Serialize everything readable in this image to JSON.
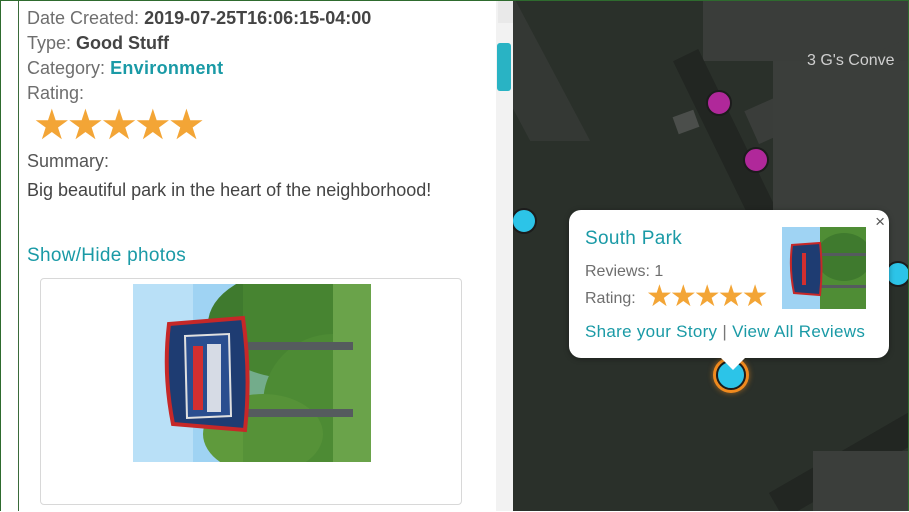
{
  "detail": {
    "date_label": "Date Created:",
    "date_value": "2019-07-25T16:06:15-04:00",
    "type_label": "Type:",
    "type_value": "Good Stuff",
    "category_label": "Category:",
    "category_value": "Environment",
    "rating_label": "Rating:",
    "rating_stars": "★★★★★",
    "rating_value": 5,
    "summary_label": "Summary:",
    "summary_text": "Big beautiful park in the heart of the neighborhood!",
    "show_hide_label": "Show/Hide photos"
  },
  "map": {
    "poi_label": "3 G's Conve",
    "popup": {
      "title": "South Park",
      "reviews_label": "Reviews: 1",
      "rating_label": "Rating:",
      "rating_stars": "★★★★★",
      "rating_value": 5,
      "share_link": "Share your Story",
      "separator": "|",
      "view_link": "View All Reviews",
      "close_glyph": "×"
    }
  },
  "colors": {
    "accent": "#1a9aa6",
    "star": "#f3a536",
    "pin_cyan": "#2cc4e8",
    "pin_purple": "#b0289a",
    "selected_glow": "#f08a1e"
  }
}
